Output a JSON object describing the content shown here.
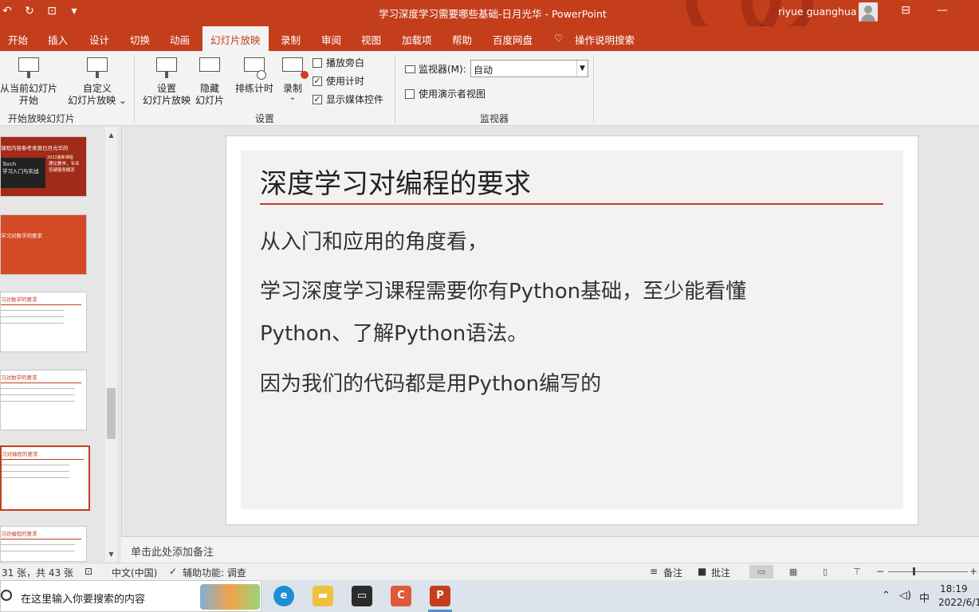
{
  "titlebar": {
    "title": "学习深度学习需要哪些基础-日月光华  -  PowerPoint",
    "user": "riyue guanghua",
    "qat_icons": [
      "autosave-icon",
      "redo-icon",
      "slideshow-icon",
      "customize-icon"
    ],
    "window_buttons": [
      "ribbon-display-icon",
      "minimize-icon"
    ]
  },
  "menu": {
    "tabs": [
      "开始",
      "插入",
      "设计",
      "切换",
      "动画",
      "幻灯片放映",
      "录制",
      "审阅",
      "视图",
      "加载项",
      "帮助",
      "百度网盘",
      "操作说明搜索"
    ],
    "active": "幻灯片放映"
  },
  "ribbon": {
    "start_group": {
      "from_current": "从当前幻灯片\n开始",
      "from_current_l1": "从当前幻灯片",
      "from_current_l2": "开始",
      "custom_l1": "自定义",
      "custom_l2": "幻灯片放映 ⌄",
      "label": "开始放映幻灯片"
    },
    "setup_group": {
      "setup_l1": "设置",
      "setup_l2": "幻灯片放映",
      "hide_l1": "隐藏",
      "hide_l2": "幻灯片",
      "rehearse": "排练计时",
      "record": "录制",
      "record_arrow": "⌄",
      "chk_narration": "播放旁白",
      "chk_timing": "使用计时",
      "chk_media": "显示媒体控件",
      "label": "设置"
    },
    "monitor_group": {
      "monitor_label": "监视器(M):",
      "monitor_value": "自动",
      "presenter_view": "使用演示者视图",
      "label": "监视器"
    }
  },
  "thumbnails": {
    "t1_top": "课程内容参考来源日月光华的",
    "t1_badge": "2022最新课程",
    "t1_box": "Torch\n学习入门与实战",
    "t1_box_l1": "Torch",
    "t1_box_l2": "学习入门与实战",
    "t1_side": "理论教学，专业\n答疑服务解答",
    "t1_side_l1": "理论教学，专业",
    "t1_side_l2": "答疑服务解答",
    "t2_title": "学习对数学的要求",
    "t3_title": "习对数学的要求",
    "t4_title": "习对数学的要求",
    "t5_title": "习对编程的要求",
    "t6_title": "习对编程的要求"
  },
  "slide": {
    "title": "深度学习对编程的要求",
    "line1": "从入门和应用的角度看，",
    "line2a": "学习深度学习课程需要你有Python基础，至少能看懂",
    "line2b": "Python、了解Python语法。",
    "line3": "因为我们的代码都是用Python编写的"
  },
  "notes": {
    "placeholder": "单击此处添加备注"
  },
  "status": {
    "slide_count": "31 张，共 43 张",
    "language": "中文(中国)",
    "accessibility": "辅助功能: 调查",
    "notes_btn": "备注",
    "comments_btn": "批注"
  },
  "taskbar": {
    "search_placeholder": "在这里输入你要搜索的内容",
    "ime": "中",
    "time": "18:19",
    "date": "2022/6/1"
  },
  "colors": {
    "accent": "#c43e1c",
    "ribbon_bg": "#f3f3f3"
  }
}
